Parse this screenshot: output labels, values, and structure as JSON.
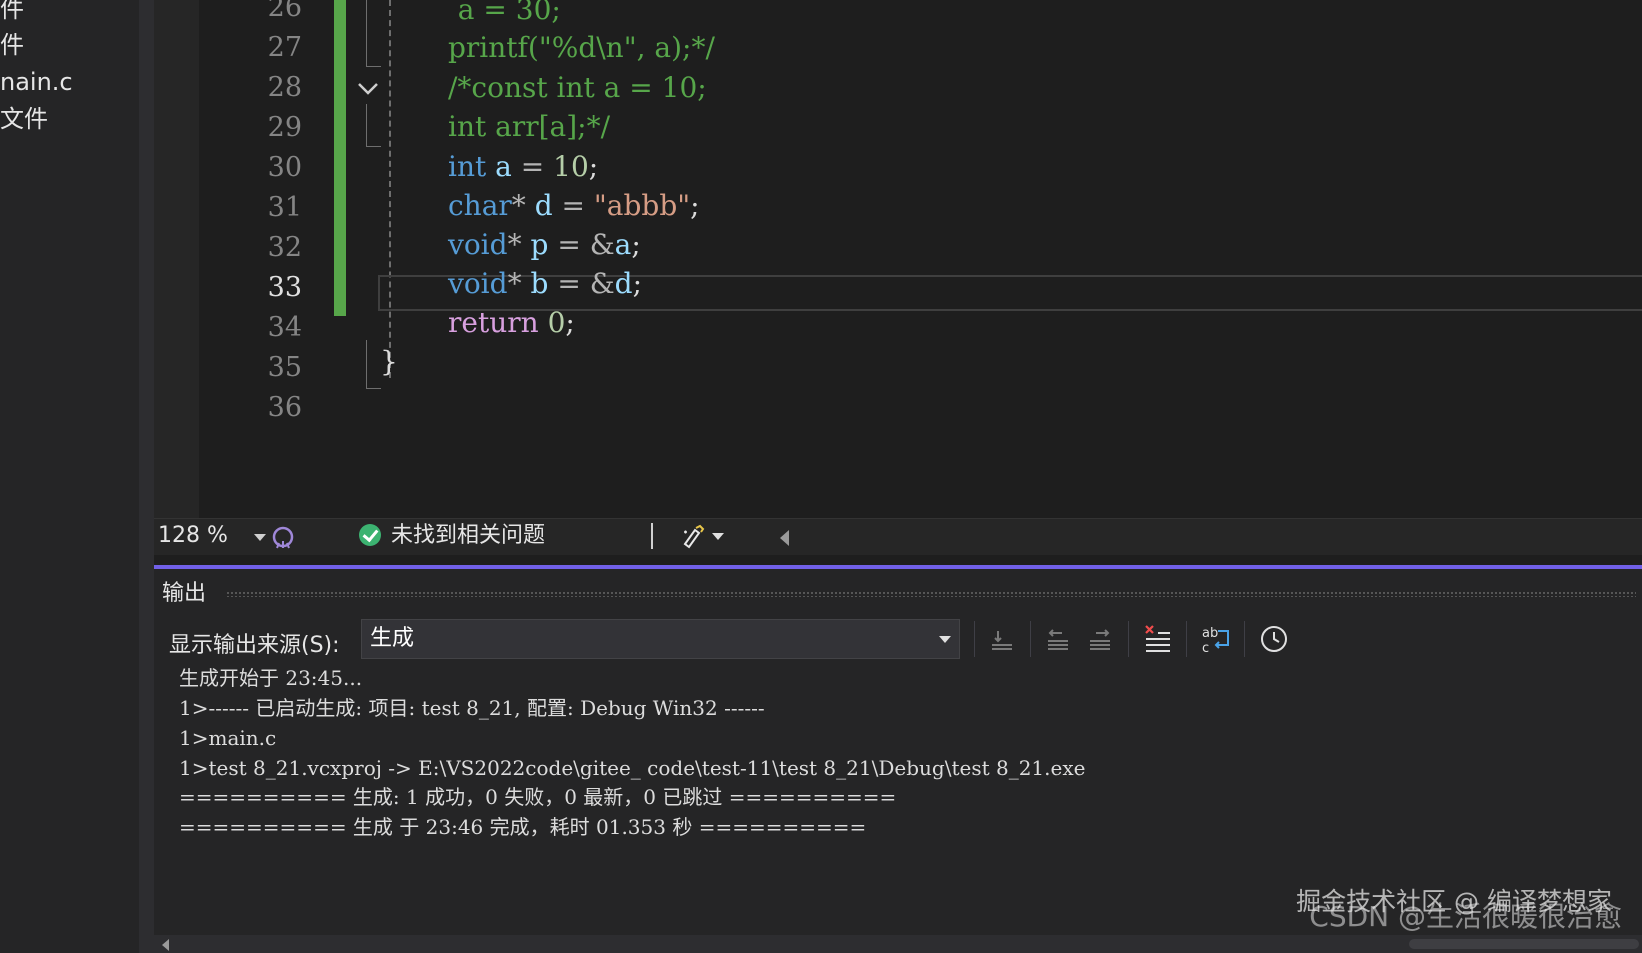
{
  "sidebar": {
    "items": [
      "件",
      "件",
      "nain.c",
      "文件"
    ]
  },
  "editor": {
    "line_numbers": [
      "26",
      "27",
      "28",
      "29",
      "30",
      "31",
      "32",
      "33",
      "34",
      "35",
      "36"
    ],
    "current_line": "33",
    "code": {
      "l26": "  a = 30;",
      "l27": "printf(\"%d\\n\", a);*/",
      "l28": "/*const int a = 10;",
      "l29": "int arr[a];*/",
      "l30_kw": "int",
      "l30_var": "a",
      "l30_op": "=",
      "l30_num": "10",
      "l30_end": ";",
      "l31_kw": "char",
      "l31_ptr": "*",
      "l31_var": "d",
      "l31_op": "=",
      "l31_str": "\"abbb\"",
      "l31_end": ";",
      "l32_kw": "void",
      "l32_ptr": "*",
      "l32_var": "p",
      "l32_op": "=",
      "l32_amp": "&",
      "l32_ref": "a",
      "l32_end": ";",
      "l33_kw": "void",
      "l33_ptr": "*",
      "l33_var": "b",
      "l33_op": "=",
      "l33_amp": "&",
      "l33_ref": "d",
      "l33_end": ";",
      "l34_kw": "return",
      "l34_num": "0",
      "l34_end": ";",
      "l35": "}"
    }
  },
  "statusbar": {
    "zoom": "128 %",
    "problems": "未找到相关问题"
  },
  "output_panel": {
    "title": "输出",
    "source_label": "显示输出来源(S):",
    "source_value": "生成",
    "lines": [
      "生成开始于 23:45...",
      "1>------ 已启动生成: 项目: test 8_21, 配置: Debug Win32 ------",
      "1>main.c",
      "1>test 8_21.vcxproj -> E:\\VS2022code\\gitee_ code\\test-11\\test 8_21\\Debug\\test 8_21.exe",
      "========== 生成: 1 成功，0 失败，0 最新，0 已跳过 ==========",
      "========== 生成 于 23:46 完成，耗时 01.353 秒 =========="
    ]
  },
  "watermark": {
    "csdn": "CSDN @生活很暖很治愈",
    "juejin": "掘金技术社区 @ 编译梦想家"
  },
  "colors": {
    "accent": "#7160e8",
    "change_bar": "#57a64a",
    "keyword": "#569cd6",
    "comment": "#57a64a",
    "string": "#d69d85",
    "number": "#b5cea8",
    "variable": "#9cdcfe",
    "control": "#d8a0df"
  }
}
